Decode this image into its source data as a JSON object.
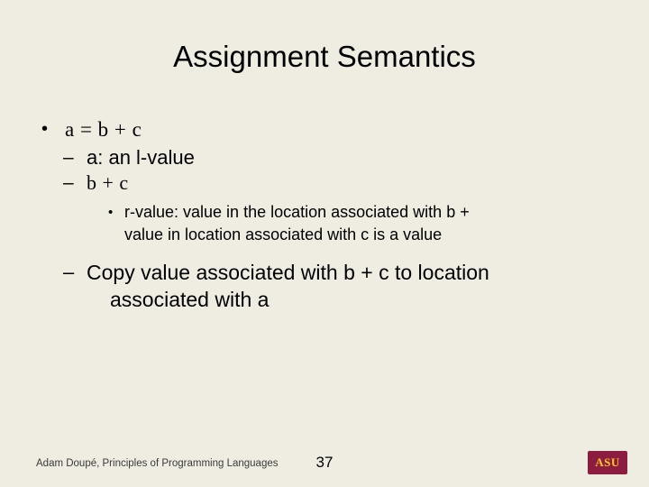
{
  "slide": {
    "title": "Assignment Semantics",
    "bullets": {
      "l1_assignment": "a  =  b  +  c",
      "l2_a": "a: an l-value",
      "l2_bc": "b  +  c",
      "l3_rvalue_line1": "r-value: value in the location associated with b  +",
      "l3_rvalue_line2": "value in location associated with c is a value",
      "l2_copy_line1": "Copy value associated with b  +  c  to location",
      "l2_copy_line2": "associated with a"
    },
    "markers": {
      "level1": "•",
      "level2": "–",
      "level3": "•"
    }
  },
  "footer": {
    "credit": "Adam Doupé, Principles of Programming Languages",
    "page_number": "37",
    "logo_text": "ASU",
    "logo_color": "#8c1d40",
    "logo_text_color": "#ffc627"
  }
}
